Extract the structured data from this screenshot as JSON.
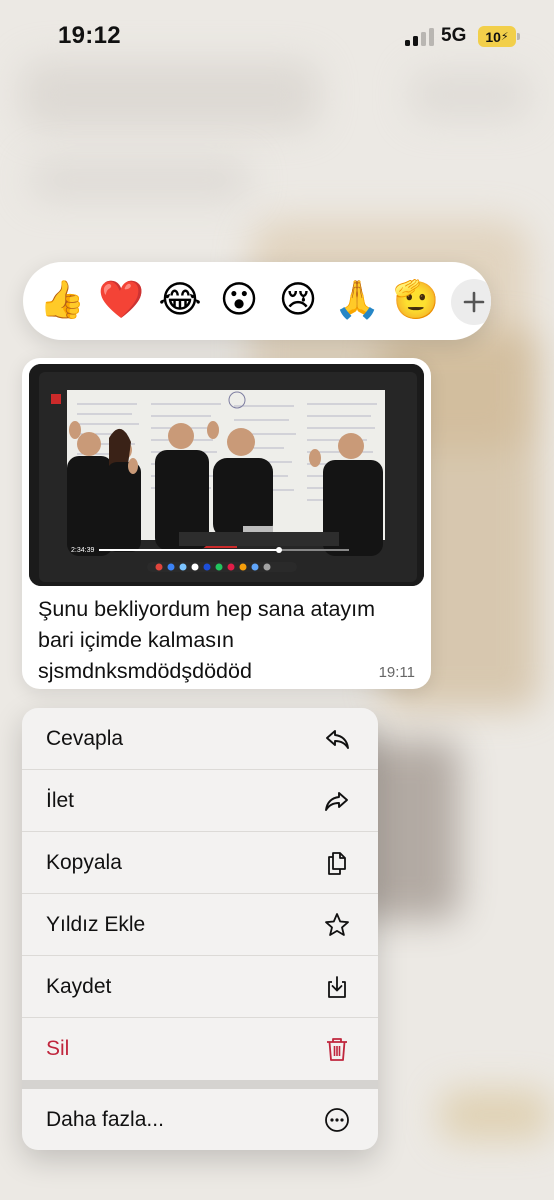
{
  "status_bar": {
    "time": "19:12",
    "network": "5G",
    "battery": "10",
    "battery_color": "#f2cf4a"
  },
  "reactions": {
    "emojis": [
      "👍",
      "❤️",
      "😂",
      "😮",
      "😢",
      "🙏",
      "🫡"
    ],
    "add_icon": "plus-icon"
  },
  "message": {
    "media": {
      "kind": "image",
      "video_timestamp": "2:34:39"
    },
    "text_lines": [
      "Şunu bekliyordum hep sana atayım",
      "bari içimde kalmasın",
      "sjsmdnksmdödşdödöd"
    ],
    "time": "19:11"
  },
  "menu": {
    "items": [
      {
        "label": "Cevapla",
        "icon": "reply-icon"
      },
      {
        "label": "İlet",
        "icon": "forward-icon"
      },
      {
        "label": "Kopyala",
        "icon": "copy-icon"
      },
      {
        "label": "Yıldız Ekle",
        "icon": "star-icon"
      },
      {
        "label": "Kaydet",
        "icon": "save-icon"
      },
      {
        "label": "Sil",
        "icon": "trash-icon",
        "destructive_color": "#c0263d"
      }
    ],
    "more": {
      "label": "Daha fazla...",
      "icon": "more-icon"
    }
  }
}
